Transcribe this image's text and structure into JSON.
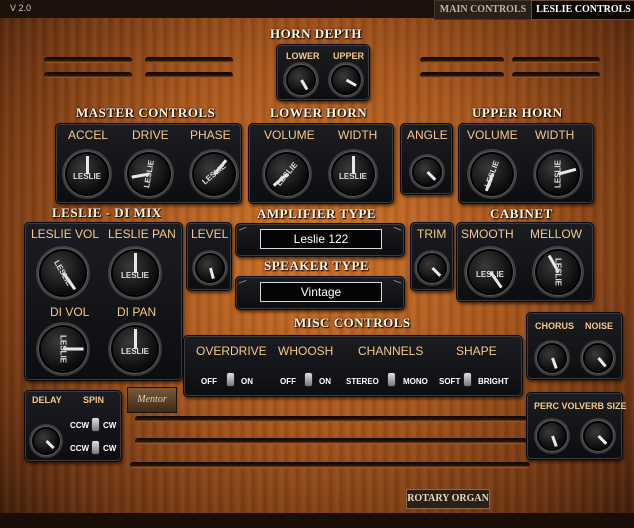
{
  "version": "V 2.0",
  "tabs": {
    "main": "MAIN CONTROLS",
    "leslie": "LESLIE CONTROLS"
  },
  "sections": {
    "horn_depth": "HORN  DEPTH",
    "master_controls": "MASTER CONTROLS",
    "lower_horn": "LOWER HORN",
    "upper_horn": "UPPER HORN",
    "leslie_di_mix": "LESLIE - DI MIX",
    "amplifier_type": "AMPLIFIER TYPE",
    "cabinet": "CABINET",
    "speaker_type": "SPEAKER TYPE",
    "misc_controls": "MISC CONTROLS"
  },
  "horn_depth": {
    "lower": "LOWER",
    "upper": "UPPER"
  },
  "master": {
    "accel": "ACCEL",
    "drive": "DRIVE",
    "phase": "PHASE"
  },
  "lower_horn": {
    "volume": "VOLUME",
    "width": "WIDTH"
  },
  "angle": "ANGLE",
  "upper_horn": {
    "volume": "VOLUME",
    "width": "WIDTH"
  },
  "mix": {
    "leslie_vol": "LESLIE VOL",
    "leslie_pan": "LESLIE PAN",
    "di_vol": "DI VOL",
    "di_pan": "DI PAN"
  },
  "level": "LEVEL",
  "trim": "TRIM",
  "amplifier_value": "Leslie 122",
  "speaker_value": "Vintage",
  "cabinet": {
    "smooth": "SMOOTH",
    "mellow": "MELLOW"
  },
  "misc": {
    "overdrive": "OVERDRIVE",
    "whoosh": "WHOOSH",
    "channels": "CHANNELS",
    "shape": "SHAPE",
    "off1": "OFF",
    "on1": "ON",
    "off2": "OFF",
    "on2": "ON",
    "stereo": "STEREO",
    "mono": "MONO",
    "soft": "SOFT",
    "bright": "BRIGHT"
  },
  "chorus": "CHORUS",
  "noise": "NOISE",
  "perc_vol": "PERC VOL",
  "verb_size": "VERB SIZE",
  "delay": "DELAY",
  "spin": "SPIN",
  "ccw1": "CCW",
  "cw1": "CW",
  "ccw2": "CCW",
  "cw2": "CW",
  "knob_text": "LESLIE",
  "logo": "Mentor",
  "brand": "ROTARY ORGAN"
}
